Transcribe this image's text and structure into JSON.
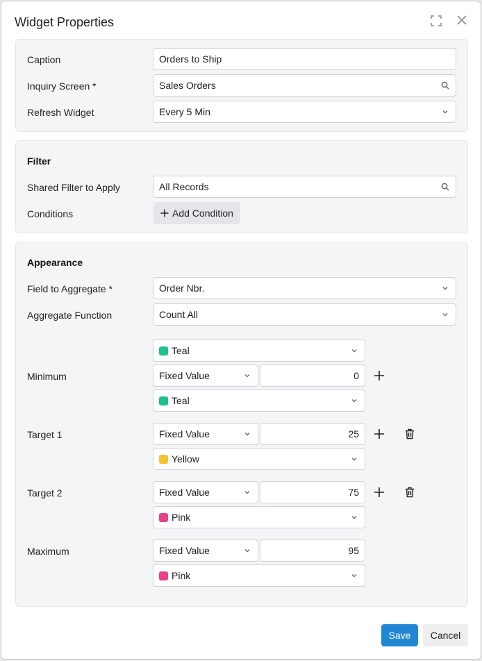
{
  "dialog": {
    "title": "Widget Properties",
    "maximize_icon": "maximize-icon",
    "close_icon": "close-icon"
  },
  "general": {
    "caption_label": "Caption",
    "caption_value": "Orders to Ship",
    "inquiry_label": "Inquiry Screen *",
    "inquiry_value": "Sales Orders",
    "refresh_label": "Refresh Widget",
    "refresh_value": "Every 5 Min"
  },
  "filter": {
    "title": "Filter",
    "shared_label": "Shared Filter to Apply",
    "shared_value": "All Records",
    "conditions_label": "Conditions",
    "add_condition": "Add Condition"
  },
  "appearance": {
    "title": "Appearance",
    "field_label": "Field to Aggregate *",
    "field_value": "Order Nbr.",
    "function_label": "Aggregate Function",
    "function_value": "Count All",
    "minimum": {
      "label": "Minimum",
      "top_color": "Teal",
      "top_color_hex": "#1fbf8f",
      "type": "Fixed Value",
      "value": "0",
      "color": "Teal",
      "color_hex": "#1fbf8f"
    },
    "target1": {
      "label": "Target 1",
      "type": "Fixed Value",
      "value": "25",
      "color": "Yellow",
      "color_hex": "#f2c233"
    },
    "target2": {
      "label": "Target 2",
      "type": "Fixed Value",
      "value": "75",
      "color": "Pink",
      "color_hex": "#e8408a"
    },
    "maximum": {
      "label": "Maximum",
      "type": "Fixed Value",
      "value": "95",
      "color": "Pink",
      "color_hex": "#e8408a"
    }
  },
  "footer": {
    "save": "Save",
    "cancel": "Cancel"
  }
}
